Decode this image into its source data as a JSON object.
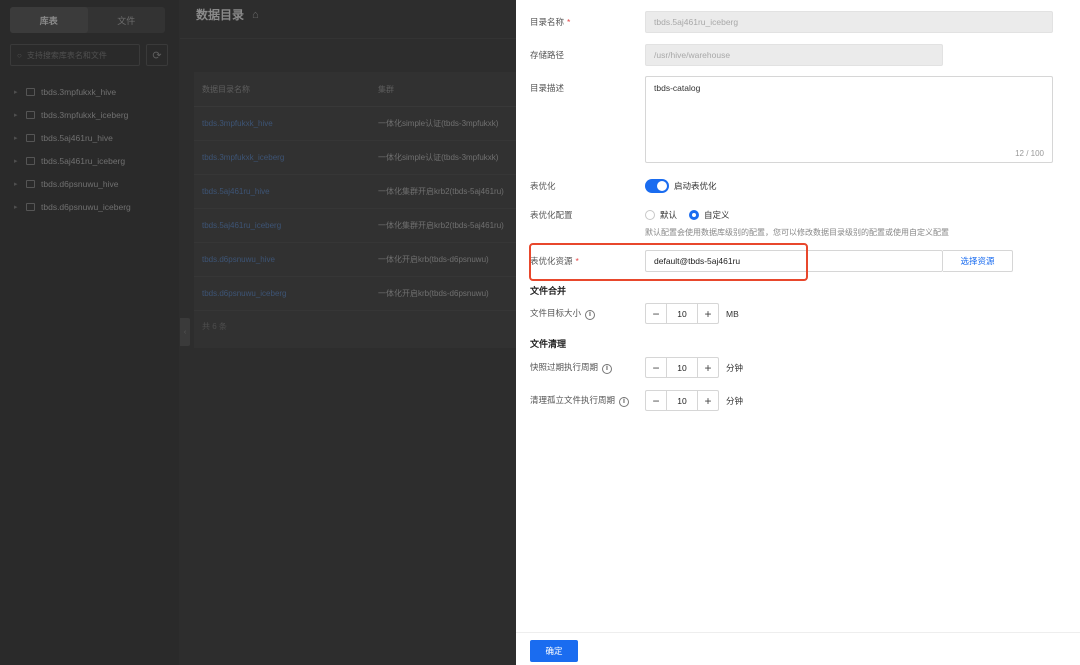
{
  "sidebar": {
    "tabs": [
      {
        "label": "库表"
      },
      {
        "label": "文件"
      }
    ],
    "search_placeholder": "支持搜索库表名和文件",
    "tree": [
      {
        "label": "tbds.3mpfukxk_hive"
      },
      {
        "label": "tbds.3mpfukxk_iceberg"
      },
      {
        "label": "tbds.5aj461ru_hive"
      },
      {
        "label": "tbds.5aj461ru_iceberg"
      },
      {
        "label": "tbds.d6psnuwu_hive"
      },
      {
        "label": "tbds.d6psnuwu_iceberg"
      }
    ]
  },
  "main": {
    "title": "数据目录",
    "table": {
      "headers": [
        "数据目录名称",
        "集群"
      ],
      "rows": [
        {
          "name": "tbds.3mpfukxk_hive",
          "cluster": "一体化simple认证(tbds-3mpfukxk)"
        },
        {
          "name": "tbds.3mpfukxk_iceberg",
          "cluster": "一体化simple认证(tbds-3mpfukxk)"
        },
        {
          "name": "tbds.5aj461ru_hive",
          "cluster": "一体化集群开启krb2(tbds-5aj461ru)"
        },
        {
          "name": "tbds.5aj461ru_iceberg",
          "cluster": "一体化集群开启krb2(tbds-5aj461ru)"
        },
        {
          "name": "tbds.d6psnuwu_hive",
          "cluster": "一体化开启krb(tbds-d6psnuwu)"
        },
        {
          "name": "tbds.d6psnuwu_iceberg",
          "cluster": "一体化开启krb(tbds-d6psnuwu)"
        }
      ],
      "total": "共 6 条"
    }
  },
  "drawer": {
    "catalog_name": {
      "label": "目录名称",
      "value": "tbds.5aj461ru_iceberg"
    },
    "storage_path": {
      "label": "存储路径",
      "value": "/usr/hive/warehouse"
    },
    "description": {
      "label": "目录描述",
      "value": "tbds-catalog",
      "counter": "12 / 100"
    },
    "table_optimize": {
      "label": "表优化",
      "switch_label": "启动表优化",
      "enabled": true
    },
    "optimize_config": {
      "label": "表优化配置",
      "options": [
        {
          "label": "默认",
          "selected": false
        },
        {
          "label": "自定义",
          "selected": true
        }
      ],
      "hint": "默认配置会使用数据库级别的配置，您可以修改数据目录级别的配置或使用自定义配置"
    },
    "optimize_resource": {
      "label": "表优化资源",
      "value": "default@tbds-5aj461ru",
      "button": "选择资源"
    },
    "file_merge": {
      "section": "文件合并",
      "target_size": {
        "label": "文件目标大小",
        "value": "10",
        "unit": "MB"
      }
    },
    "file_cleanup": {
      "section": "文件清理",
      "snapshot_expire": {
        "label": "快照过期执行周期",
        "value": "10",
        "unit": "分钟"
      },
      "orphan_cleanup": {
        "label": "清理孤立文件执行周期",
        "value": "10",
        "unit": "分钟"
      }
    },
    "confirm": "确定"
  }
}
